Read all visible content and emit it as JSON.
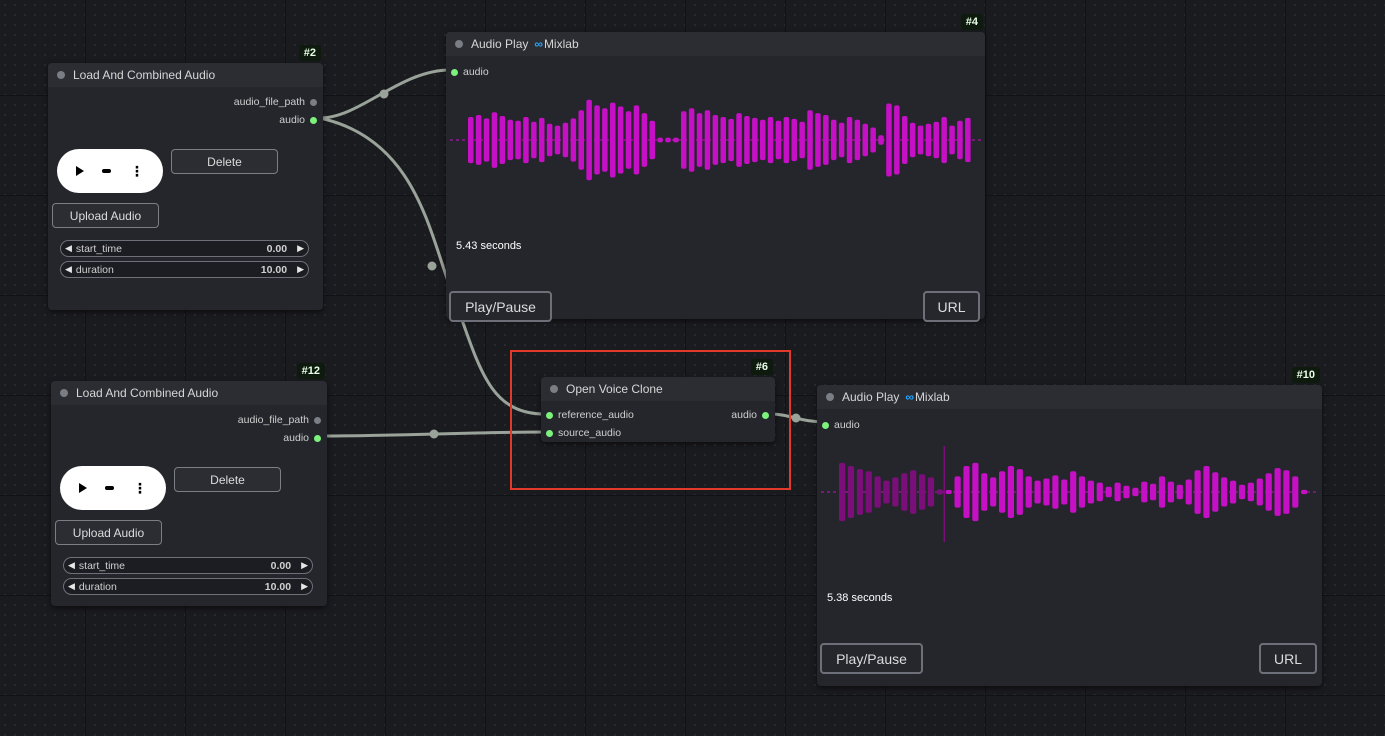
{
  "nodes": {
    "load1": {
      "badge": "#2",
      "title": "Load And Combined Audio",
      "outputs": [
        "audio_file_path",
        "audio"
      ],
      "delete_label": "Delete",
      "upload_label": "Upload Audio",
      "start_time": {
        "name": "start_time",
        "value": "0.00"
      },
      "duration": {
        "name": "duration",
        "value": "10.00"
      }
    },
    "load2": {
      "badge": "#12",
      "title": "Load And Combined Audio",
      "outputs": [
        "audio_file_path",
        "audio"
      ],
      "delete_label": "Delete",
      "upload_label": "Upload Audio",
      "start_time": {
        "name": "start_time",
        "value": "0.00"
      },
      "duration": {
        "name": "duration",
        "value": "10.00"
      }
    },
    "play1": {
      "badge": "#4",
      "title": "Audio Play",
      "brand": "Mixlab",
      "brand_icon": "infinity-icon",
      "input": "audio",
      "seconds": "5.43 seconds",
      "play_label": "Play/Pause",
      "url_label": "URL"
    },
    "voice": {
      "badge": "#6",
      "title": "Open Voice Clone",
      "inputs": [
        "reference_audio",
        "source_audio"
      ],
      "output": "audio"
    },
    "play2": {
      "badge": "#10",
      "title": "Audio Play",
      "brand": "Mixlab",
      "brand_icon": "infinity-icon",
      "input": "audio",
      "seconds": "5.38 seconds",
      "play_label": "Play/Pause",
      "url_label": "URL"
    }
  },
  "colors": {
    "wire": "#9aa39a",
    "waveform": "#c510c5",
    "waveform_played": "#7a0f7a",
    "highlight": "#e23a2a",
    "slot_connected": "#7cf27c"
  },
  "waveforms": {
    "play1": [
      0.48,
      0.52,
      0.45,
      0.58,
      0.5,
      0.42,
      0.4,
      0.48,
      0.38,
      0.46,
      0.34,
      0.3,
      0.36,
      0.45,
      0.62,
      0.84,
      0.72,
      0.66,
      0.78,
      0.7,
      0.6,
      0.72,
      0.56,
      0.4,
      0.05,
      0.05,
      0.05,
      0.6,
      0.66,
      0.56,
      0.62,
      0.52,
      0.48,
      0.44,
      0.56,
      0.5,
      0.46,
      0.42,
      0.48,
      0.4,
      0.48,
      0.44,
      0.38,
      0.62,
      0.56,
      0.52,
      0.42,
      0.36,
      0.48,
      0.42,
      0.34,
      0.26,
      0.1,
      0.76,
      0.72,
      0.5,
      0.36,
      0.3,
      0.34,
      0.38,
      0.48,
      0.3,
      0.4,
      0.46
    ],
    "play2": [
      0.56,
      0.5,
      0.44,
      0.4,
      0.3,
      0.22,
      0.28,
      0.36,
      0.42,
      0.34,
      0.28,
      0.05,
      0.02,
      0.3,
      0.5,
      0.56,
      0.36,
      0.28,
      0.4,
      0.5,
      0.44,
      0.3,
      0.22,
      0.26,
      0.32,
      0.24,
      0.4,
      0.3,
      0.22,
      0.18,
      0.1,
      0.18,
      0.12,
      0.08,
      0.2,
      0.16,
      0.3,
      0.2,
      0.14,
      0.24,
      0.42,
      0.5,
      0.38,
      0.28,
      0.22,
      0.14,
      0.18,
      0.26,
      0.36,
      0.46,
      0.42,
      0.3,
      0.04
    ],
    "play2_played_bars": 12
  }
}
